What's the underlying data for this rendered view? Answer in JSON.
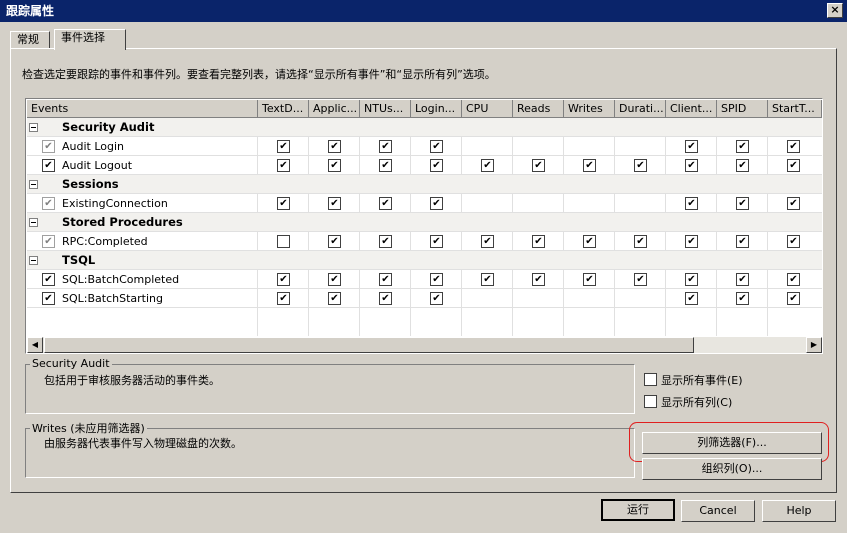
{
  "window": {
    "title": "跟踪属性",
    "close_label": "×"
  },
  "tabs": [
    {
      "label": "常规"
    },
    {
      "label": "事件选择"
    }
  ],
  "instruction": "检查选定要跟踪的事件和事件列。要查看完整列表，请选择“显示所有事件”和“显示所有列”选项。",
  "grid": {
    "columns": [
      "Events",
      "TextD...",
      "Applic...",
      "NTUs...",
      "Login...",
      "CPU",
      "Reads",
      "Writes",
      "Durati...",
      "Client...",
      "SPID",
      "StartT..."
    ],
    "rows": [
      {
        "type": "category",
        "label": "Security Audit"
      },
      {
        "type": "event",
        "label": "Audit Login",
        "row_checked": true,
        "row_disabled": true,
        "cells": [
          true,
          true,
          true,
          true,
          false,
          false,
          false,
          false,
          true,
          true,
          true
        ]
      },
      {
        "type": "event",
        "label": "Audit Logout",
        "row_checked": true,
        "row_disabled": false,
        "cells": [
          true,
          true,
          true,
          true,
          true,
          true,
          true,
          true,
          true,
          true,
          true
        ]
      },
      {
        "type": "category",
        "label": "Sessions"
      },
      {
        "type": "event",
        "label": "ExistingConnection",
        "row_checked": true,
        "row_disabled": true,
        "cells": [
          true,
          true,
          true,
          true,
          false,
          false,
          false,
          false,
          true,
          true,
          true
        ]
      },
      {
        "type": "category",
        "label": "Stored Procedures"
      },
      {
        "type": "event",
        "label": "RPC:Completed",
        "row_checked": true,
        "row_disabled": true,
        "cells": [
          false,
          true,
          true,
          true,
          true,
          true,
          true,
          true,
          true,
          true,
          true
        ]
      },
      {
        "type": "category",
        "label": "TSQL"
      },
      {
        "type": "event",
        "label": "SQL:BatchCompleted",
        "row_checked": true,
        "row_disabled": false,
        "cells": [
          true,
          true,
          true,
          true,
          true,
          true,
          true,
          true,
          true,
          true,
          true
        ]
      },
      {
        "type": "event",
        "label": "SQL:BatchStarting",
        "row_checked": true,
        "row_disabled": false,
        "cells": [
          true,
          true,
          true,
          true,
          false,
          false,
          false,
          false,
          true,
          true,
          true
        ]
      }
    ]
  },
  "event_group": {
    "title": "Security Audit",
    "description": "包括用于审核服务器活动的事件类。"
  },
  "column_group": {
    "title": "Writes (未应用筛选器)",
    "description": "由服务器代表事件写入物理磁盘的次数。"
  },
  "options": {
    "show_all_events": {
      "label": "显示所有事件(E)",
      "checked": false
    },
    "show_all_columns": {
      "label": "显示所有列(C)",
      "checked": false
    }
  },
  "buttons": {
    "column_filters": "列筛选器(F)...",
    "organize_columns": "组织列(O)...",
    "run": "运行",
    "cancel": "Cancel",
    "help": "Help"
  },
  "check_glyph": "✔",
  "scroll": {
    "left_arrow": "◀",
    "right_arrow": "▶"
  },
  "colors": {
    "titlebar": "#0a246a",
    "dialog_bg": "#d4d0c8",
    "highlight": "#e02020"
  }
}
